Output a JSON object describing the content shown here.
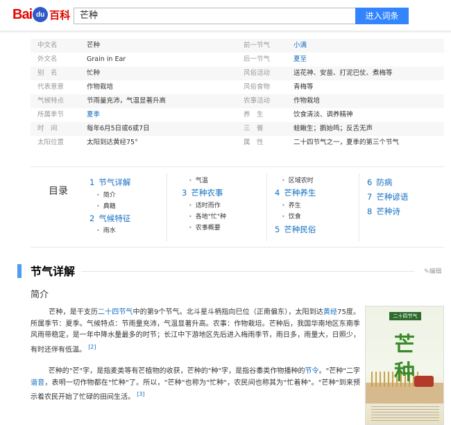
{
  "header": {
    "logo_text_1": "Bai",
    "logo_paw_text": "du",
    "logo_text_2": "百科",
    "search_value": "芒种",
    "search_button": "进入词条"
  },
  "info": [
    {
      "k1": "中文名",
      "v1": "芒种",
      "k2": "前一节气",
      "v2": "小满",
      "v2_link": true
    },
    {
      "k1": "外文名",
      "v1": "Grain in Ear",
      "k2": "后一节气",
      "v2": "夏至",
      "v2_link": true
    },
    {
      "k1": "别　名",
      "v1": "忙种",
      "k2": "风俗活动",
      "v2": "送花神、安苗、打泥巴仗、煮梅等"
    },
    {
      "k1": "代表意意",
      "v1": "作物栽培",
      "k2": "风俗食物",
      "v2": "青梅等"
    },
    {
      "k1": "气候特点",
      "v1": "节雨量充沛，气温显著升高",
      "k2": "农事活动",
      "v2": "作物栽培"
    },
    {
      "k1": "所属季节",
      "v1": "夏季",
      "v1_link": true,
      "k2": "养　生",
      "v2": "饮食清淡、调养精神"
    },
    {
      "k1": "时　间",
      "v1": "每年6月5日或6或7日",
      "k2": "三　餐",
      "v2": "蛙鳅生；鹅始鸣；反舌无声"
    },
    {
      "k1": "太阳位置",
      "v1": "太阳到达黄经75°",
      "k2": "属　性",
      "v2": "二十四节气之一，夏季的第三个节气"
    }
  ],
  "toc": {
    "title": "目录",
    "col1": [
      {
        "n": "1",
        "label": "节气详解",
        "sub": [
          "简介",
          "典籍"
        ]
      },
      {
        "n": "2",
        "label": "气候特征",
        "sub": [
          "雨水"
        ]
      }
    ],
    "col2": {
      "top_sub": [
        "气温"
      ],
      "items": [
        {
          "n": "3",
          "label": "芒种农事",
          "sub": [
            "适时而作",
            "各地\"忙\"种",
            "农事概要"
          ]
        }
      ]
    },
    "col3": {
      "top_sub": [
        "区域农时"
      ],
      "items": [
        {
          "n": "4",
          "label": "芒种养生",
          "sub": [
            "养生",
            "饮食"
          ]
        },
        {
          "n": "5",
          "label": "芒种民俗",
          "sub": []
        }
      ]
    },
    "col4": [
      {
        "n": "6",
        "label": "防病"
      },
      {
        "n": "7",
        "label": "芒种谚语"
      },
      {
        "n": "8",
        "label": "芒种诗"
      }
    ]
  },
  "section": {
    "title": "节气详解",
    "edit": "✎编辑",
    "subtitle": "简介"
  },
  "paragraph1": {
    "t1": "芒种，是干支历",
    "l1": "二十四节气",
    "t2": "中的第9个节气。北斗星斗柄指向巳位（正南偏东），太阳到达",
    "l2": "黄经",
    "t3": "75度。所属季节：夏季。气候特点：节雨量充沛，气温显著升高。农事：作物栽培。芒种后，我国华南地区东南季风雨带稳定，是一年中降水量最多的时节；长江中下游地区先后进入梅雨季节，雨日多，雨量大，日照少，有时还伴有低温。",
    "ref": "[2]"
  },
  "paragraph2": {
    "t1": "芒种的\"芒\"字，是指麦类等有芒植物的收获，芒种的\"种\"字，是指谷黍类作物播种的",
    "l1": "节令",
    "t2": "。\"芒种\"二字",
    "l2": "谐音",
    "t3": "，表明一切作物都在\"忙种\"了。所以，\"芒种\"也称为\"忙种\"，农民间也称其为\"忙着种\"。\"芒种\"到来预示着农民开始了忙碌的田间生活。",
    "ref": "[3]"
  },
  "cover": {
    "tag": "二十四节气",
    "big1": "芒",
    "big2": "种"
  },
  "colors": {
    "brand_red": "#e10602",
    "brand_blue": "#2f59c7",
    "link": "#136ec2",
    "button": "#3385ff",
    "section_bar": "#4f9cee"
  }
}
